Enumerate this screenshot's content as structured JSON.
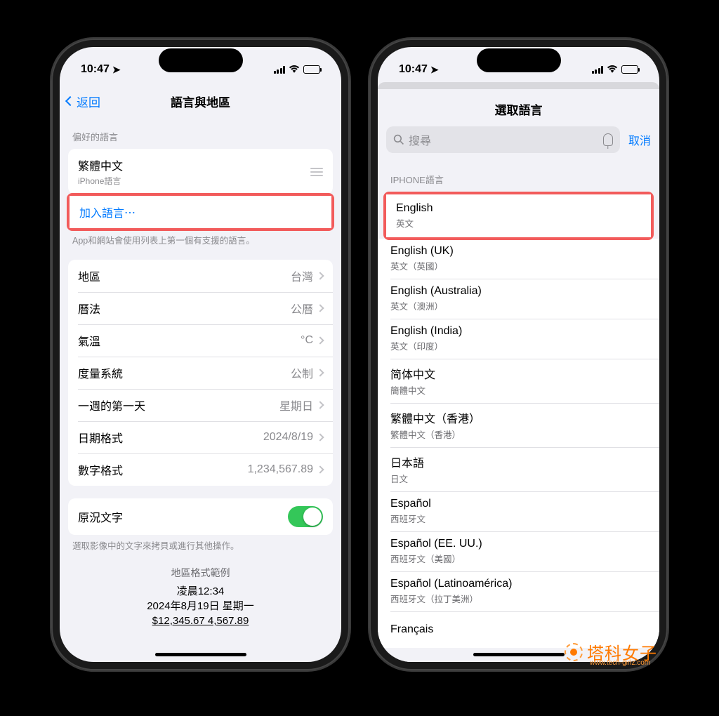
{
  "statusbar": {
    "time": "10:47"
  },
  "phone1": {
    "back_label": "返回",
    "title": "語言與地區",
    "preferred_header": "偏好的語言",
    "current_language": {
      "name": "繁體中文",
      "sub": "iPhone語言"
    },
    "add_language": "加入語言⋯",
    "preferred_footer": "App和網站會使用列表上第一個有支援的語言。",
    "settings": [
      {
        "label": "地區",
        "value": "台灣"
      },
      {
        "label": "曆法",
        "value": "公曆"
      },
      {
        "label": "氣溫",
        "value": "°C"
      },
      {
        "label": "度量系統",
        "value": "公制"
      },
      {
        "label": "一週的第一天",
        "value": "星期日"
      },
      {
        "label": "日期格式",
        "value": "2024/8/19"
      },
      {
        "label": "數字格式",
        "value": "1,234,567.89"
      }
    ],
    "live_text": {
      "label": "原況文字",
      "on": true
    },
    "live_text_footer": "選取影像中的文字來拷貝或進行其他操作。",
    "example": {
      "header": "地區格式範例",
      "time": "凌晨12:34",
      "date": "2024年8月19日 星期一",
      "numbers": "$12,345.67   4,567.89"
    }
  },
  "phone2": {
    "title": "選取語言",
    "search_placeholder": "搜尋",
    "cancel": "取消",
    "section_header": "IPHONE語言",
    "languages": [
      {
        "native": "English",
        "loc": "英文"
      },
      {
        "native": "English (UK)",
        "loc": "英文（英國）"
      },
      {
        "native": "English (Australia)",
        "loc": "英文（澳洲）"
      },
      {
        "native": "English (India)",
        "loc": "英文（印度）"
      },
      {
        "native": "简体中文",
        "loc": "簡體中文"
      },
      {
        "native": "繁體中文（香港）",
        "loc": "繁體中文（香港）"
      },
      {
        "native": "日本語",
        "loc": "日文"
      },
      {
        "native": "Español",
        "loc": "西班牙文"
      },
      {
        "native": "Español (EE. UU.)",
        "loc": "西班牙文（美國）"
      },
      {
        "native": "Español (Latinoamérica)",
        "loc": "西班牙文（拉丁美洲）"
      },
      {
        "native": "Français",
        "loc": ""
      }
    ]
  },
  "watermark": {
    "text": "塔科女子",
    "url": "www.tech-girlz.com"
  }
}
